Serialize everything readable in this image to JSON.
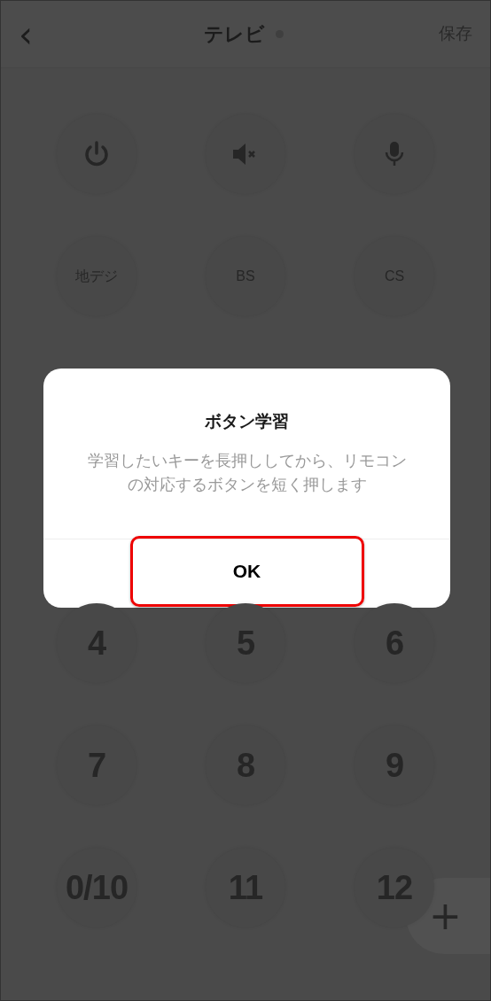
{
  "header": {
    "back": "‹",
    "title": "テレビ",
    "status_dot": true,
    "save": "保存"
  },
  "top_keys": [
    {
      "kind": "power"
    },
    {
      "kind": "mute"
    },
    {
      "kind": "mic"
    }
  ],
  "channel_keys": [
    {
      "label": "地デジ"
    },
    {
      "label": "BS"
    },
    {
      "label": "CS"
    }
  ],
  "number_keys": [
    {
      "label": "4"
    },
    {
      "label": "5"
    },
    {
      "label": "6"
    },
    {
      "label": "7"
    },
    {
      "label": "8"
    },
    {
      "label": "9"
    },
    {
      "label": "0/10"
    },
    {
      "label": "11"
    },
    {
      "label": "12"
    }
  ],
  "add_button": "+",
  "dialog": {
    "title": "ボタン学習",
    "message": "学習したいキーを長押ししてから、リモコンの対応するボタンを短く押します",
    "button": {
      "label": "OK",
      "highlighted": true
    }
  }
}
